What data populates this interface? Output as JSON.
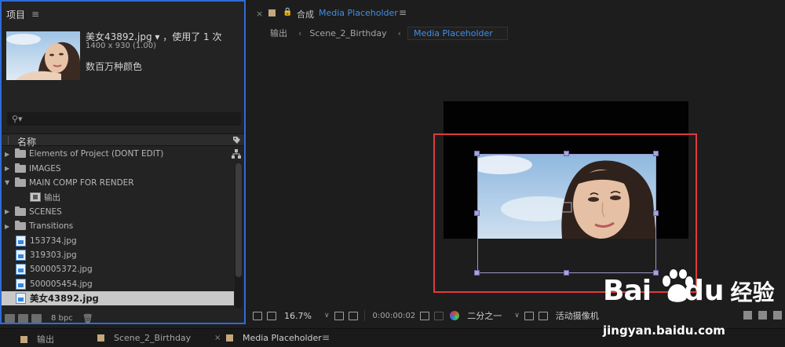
{
  "project_panel": {
    "title": "项目",
    "item": {
      "name_line": "美女43892.jpg ▾ ，使用了 1 次",
      "dimensions": "1400 x 930 (1.00)",
      "colors": "数百万种颜色"
    },
    "search_placeholder": "",
    "column_name": "名称",
    "items": [
      {
        "label": "Elements of Project (DONT EDIT)",
        "type": "folder",
        "expanded": false
      },
      {
        "label": "IMAGES",
        "type": "folder",
        "expanded": false
      },
      {
        "label": "MAIN COMP FOR RENDER",
        "type": "folder",
        "expanded": true
      },
      {
        "label": "输出",
        "type": "comp"
      },
      {
        "label": "SCENES",
        "type": "folder",
        "expanded": false
      },
      {
        "label": "Transitions",
        "type": "folder",
        "expanded": false
      },
      {
        "label": "153734.jpg",
        "type": "image"
      },
      {
        "label": "319303.jpg",
        "type": "image"
      },
      {
        "label": "500005372.jpg",
        "type": "image"
      },
      {
        "label": "500005454.jpg",
        "type": "image"
      },
      {
        "label": "美女43892.jpg",
        "type": "image",
        "selected": true
      }
    ],
    "bpc": "8 bpc"
  },
  "comp_panel": {
    "tab_prefix": "合成",
    "tab_name": "Media Placeholder",
    "breadcrumbs": [
      "输出",
      "Scene_2_Birthday",
      "Media Placeholder"
    ]
  },
  "viewer_toolbar": {
    "zoom": "16.7%",
    "timecode": "0:00:00:02",
    "resolution": "二分之一",
    "camera": "活动摄像机"
  },
  "bottom_tabs": [
    "输出",
    "Scene_2_Birthday",
    "Media Placeholder"
  ],
  "watermark": {
    "bai": "Bai",
    "du": "du",
    "jingyan": "经验",
    "url": "jingyan.baidu.com"
  },
  "colors": {
    "accent": "#3f8fe8",
    "highlight_box": "#e03a3a",
    "panel_bg": "#232323",
    "selected_row": "#c9c9c9"
  }
}
